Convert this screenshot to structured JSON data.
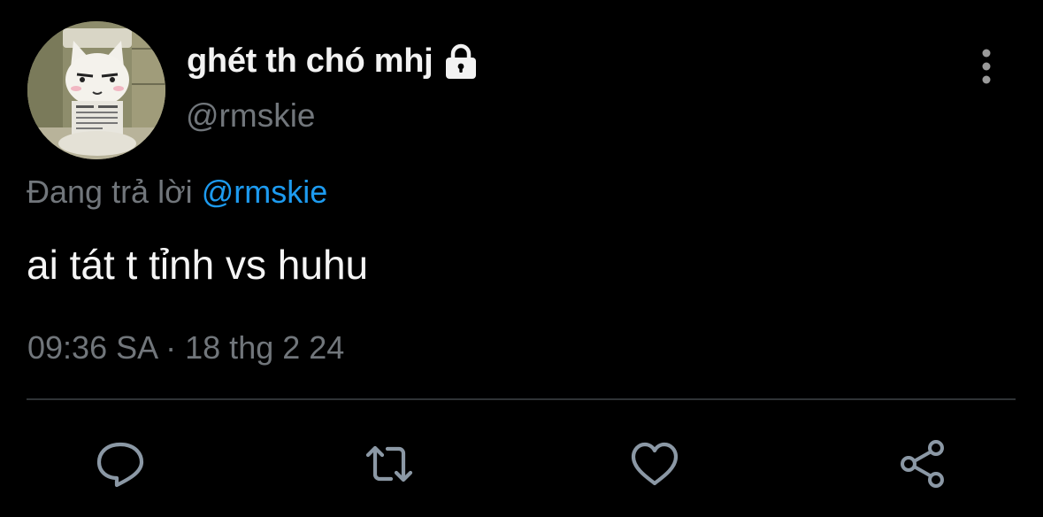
{
  "tweet": {
    "display_name": "ghét th chó mhj",
    "handle": "@rmskie",
    "reply_prefix": "Đang trả lời ",
    "reply_to": "@rmskie",
    "text": "ai tát t tỉnh vs huhu",
    "time": "09:36 SA",
    "separator": " · ",
    "date": "18 thg 2 24"
  },
  "icons": {
    "lock": "lock-icon",
    "more": "more-vertical-icon",
    "reply": "reply-icon",
    "retweet": "retweet-icon",
    "like": "heart-icon",
    "share": "share-icon"
  },
  "colors": {
    "background": "#000000",
    "text_primary": "#e7e9ea",
    "text_secondary": "#71767b",
    "mention": "#1d9bf0",
    "divider": "#2f3336"
  }
}
